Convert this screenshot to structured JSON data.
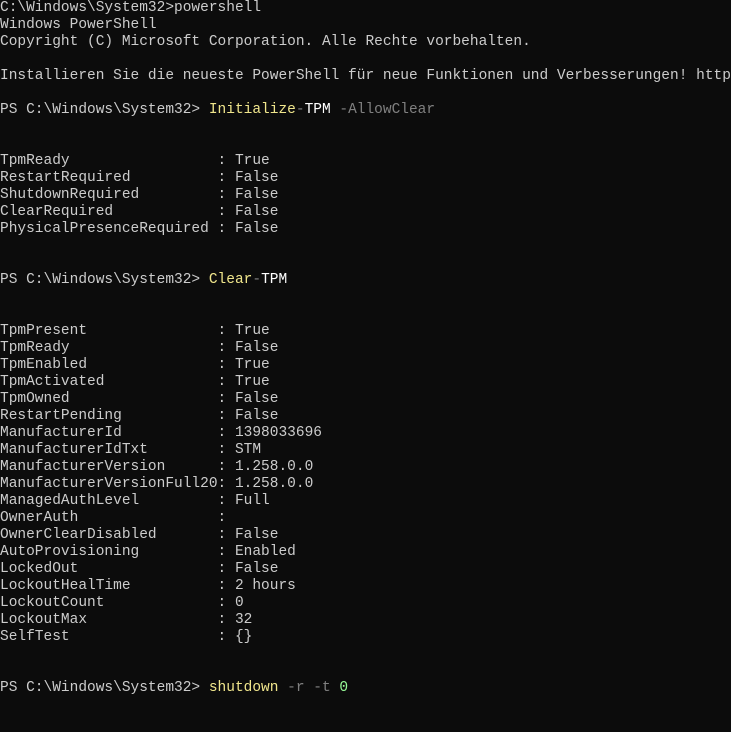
{
  "header": {
    "path_line": "C:\\Windows\\System32>powershell",
    "ps_title": "Windows PowerShell",
    "copyright": "Copyright (C) Microsoft Corporation. Alle Rechte vorbehalten.",
    "install_msg": "Installieren Sie die neueste PowerShell für neue Funktionen und Verbesserungen! https://aka.ms/"
  },
  "prompt": "PS C:\\Windows\\System32> ",
  "cmd1": {
    "name": "Initialize",
    "dash": "-",
    "arg": "TPM",
    "param": " -AllowClear"
  },
  "cmd2": {
    "name": "Clear",
    "dash": "-",
    "arg": "TPM"
  },
  "cmd3": {
    "cmd": "shutdown",
    "flags": " -r -t ",
    "num": "0"
  },
  "block1": [
    {
      "k": "TpmReady",
      "v": "True"
    },
    {
      "k": "RestartRequired",
      "v": "False"
    },
    {
      "k": "ShutdownRequired",
      "v": "False"
    },
    {
      "k": "ClearRequired",
      "v": "False"
    },
    {
      "k": "PhysicalPresenceRequired",
      "v": "False"
    }
  ],
  "block2": [
    {
      "k": "TpmPresent",
      "v": "True"
    },
    {
      "k": "TpmReady",
      "v": "False"
    },
    {
      "k": "TpmEnabled",
      "v": "True"
    },
    {
      "k": "TpmActivated",
      "v": "True"
    },
    {
      "k": "TpmOwned",
      "v": "False"
    },
    {
      "k": "RestartPending",
      "v": "False"
    },
    {
      "k": "ManufacturerId",
      "v": "1398033696"
    },
    {
      "k": "ManufacturerIdTxt",
      "v": "STM"
    },
    {
      "k": "ManufacturerVersion",
      "v": "1.258.0.0"
    },
    {
      "k": "ManufacturerVersionFull20",
      "v": "1.258.0.0"
    },
    {
      "k": "ManagedAuthLevel",
      "v": "Full"
    },
    {
      "k": "OwnerAuth",
      "v": ""
    },
    {
      "k": "OwnerClearDisabled",
      "v": "False"
    },
    {
      "k": "AutoProvisioning",
      "v": "Enabled"
    },
    {
      "k": "LockedOut",
      "v": "False"
    },
    {
      "k": "LockoutHealTime",
      "v": "2 hours"
    },
    {
      "k": "LockoutCount",
      "v": "0"
    },
    {
      "k": "LockoutMax",
      "v": "32"
    },
    {
      "k": "SelfTest",
      "v": "{}"
    }
  ]
}
